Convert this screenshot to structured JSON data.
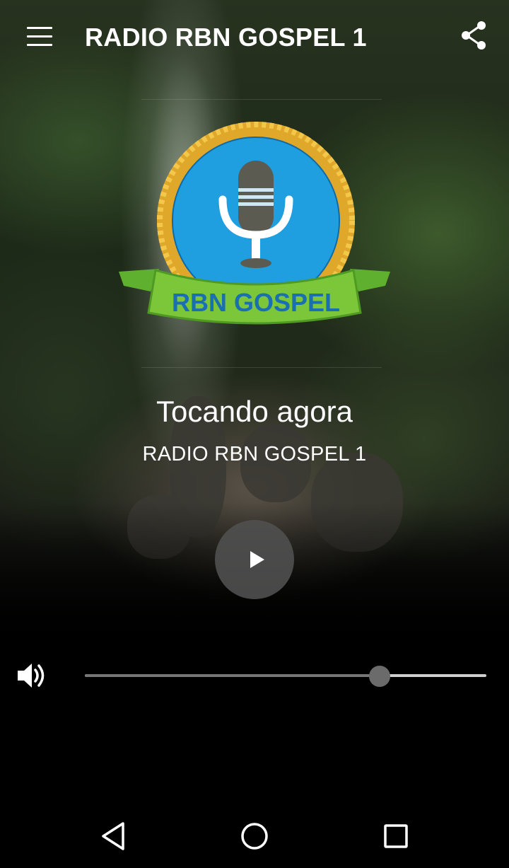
{
  "app": {
    "title": "RADIO RBN GOSPEL 1"
  },
  "logo": {
    "banner_text": "RBN GOSPEL"
  },
  "player": {
    "now_playing_label": "Tocando agora",
    "station_name": "RADIO RBN GOSPEL 1",
    "state": "paused",
    "volume_fraction": 0.735
  },
  "icons": {
    "menu": "hamburger-menu-icon",
    "share": "share-icon",
    "play": "play-icon",
    "volume": "volume-up-icon",
    "back": "back-triangle-icon",
    "home": "home-circle-icon",
    "recents": "recents-square-icon"
  },
  "colors": {
    "logo_blue": "#1f9fe0",
    "logo_gold": "#e0a82a",
    "banner_green": "#7cc63a",
    "banner_text": "#1a6fb0"
  }
}
